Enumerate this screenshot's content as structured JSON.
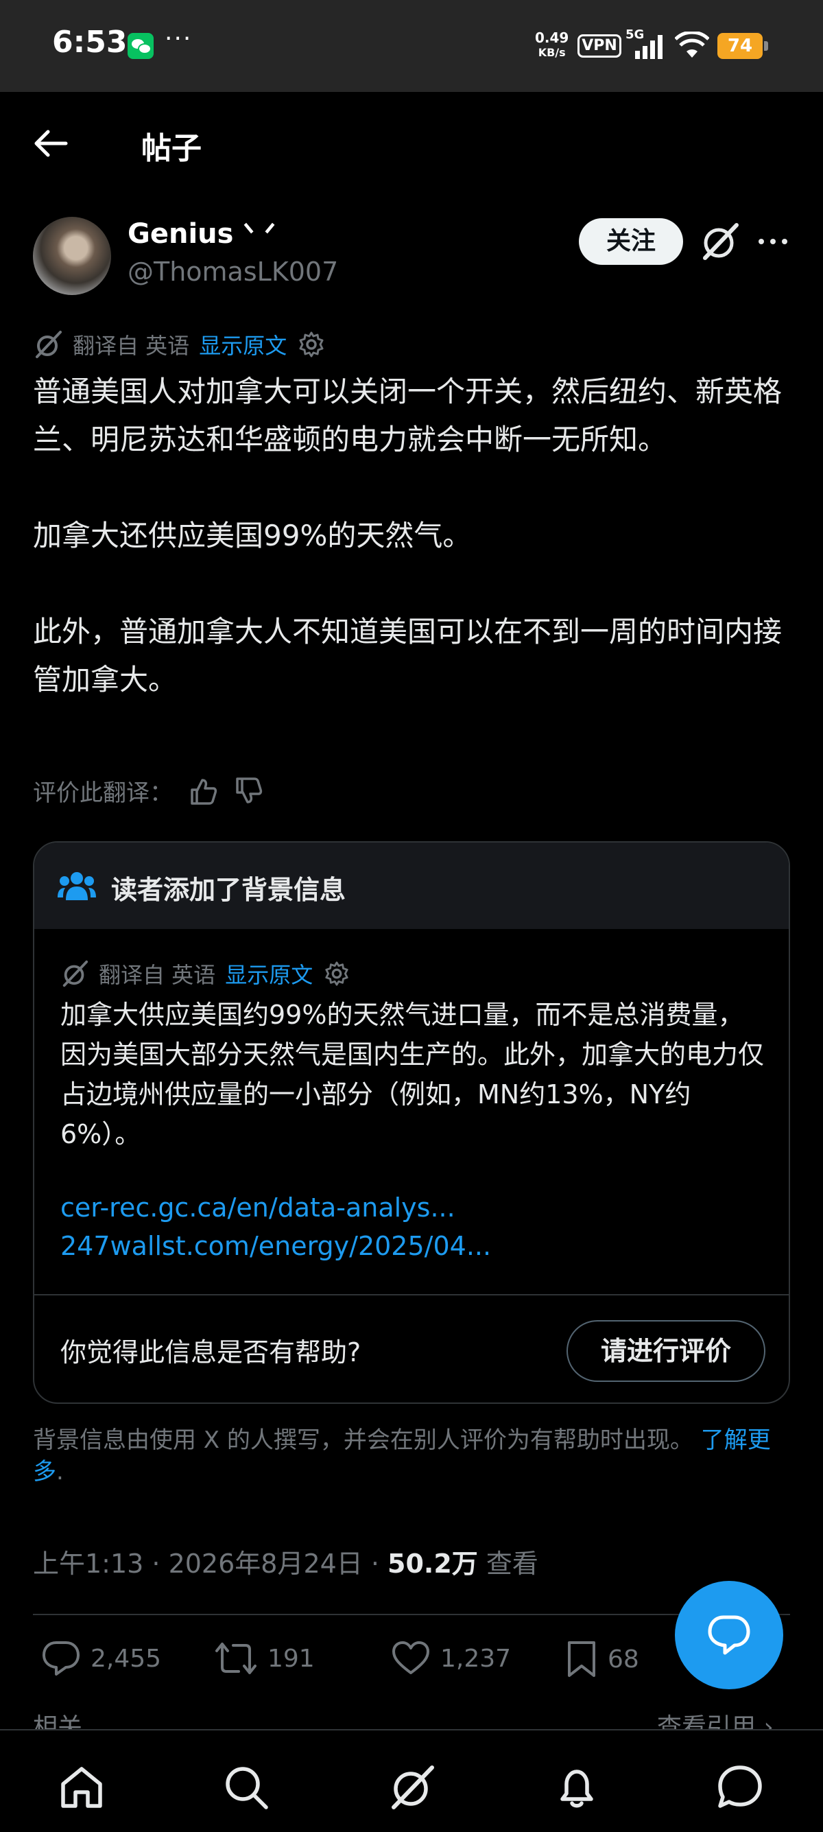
{
  "status_bar": {
    "time": "6:53",
    "more": "···",
    "net_speed_value": "0.49",
    "net_speed_unit": "KB/s",
    "vpn": "VPN",
    "network": "5G",
    "battery": "74"
  },
  "header": {
    "title": "帖子"
  },
  "post": {
    "display_name": "Genius ᐠ   ᐟ",
    "handle": "@ThomasLK007",
    "follow_label": "关注",
    "translated_from": "翻译自 英语",
    "show_original": "显示原文",
    "paragraphs": [
      "普通美国人对加拿大可以关闭一个开关，然后纽约、新英格兰、明尼苏达和华盛顿的电力就会中断一无所知。",
      "加拿大还供应美国99%的天然气。",
      "此外，普通加拿大人不知道美国可以在不到一周的时间内接管加拿大。"
    ],
    "rate_translation": "评价此翻译："
  },
  "note": {
    "title": "读者添加了背景信息",
    "translated_from": "翻译自 英语",
    "show_original": "显示原文",
    "body": "加拿大供应美国约99%的天然气进口量，而不是总消费量，因为美国大部分天然气是国内生产的。此外，加拿大的电力仅占边境州供应量的一小部分（例如，MN约13%，NY约6%）。",
    "links": [
      "cer-rec.gc.ca/en/data-analys...",
      "247wallst.com/energy/2025/04..."
    ],
    "question": "你觉得此信息是否有帮助?",
    "rate_button": "请进行评价"
  },
  "note_footer": {
    "text": "背景信息由使用 X 的人撰写，并会在别人评价为有帮助时出现。 ",
    "learn_more": "了解更多",
    "period": "."
  },
  "meta": {
    "time": "上午1:13 · 2026年8月24日 · ",
    "views_count": "50.2万",
    "views_label": " 查看"
  },
  "actions": {
    "replies": "2,455",
    "reposts": "191",
    "likes": "1,237",
    "bookmarks": "68"
  },
  "related": "相关⌄",
  "view_quotes": "查看引用 ›"
}
